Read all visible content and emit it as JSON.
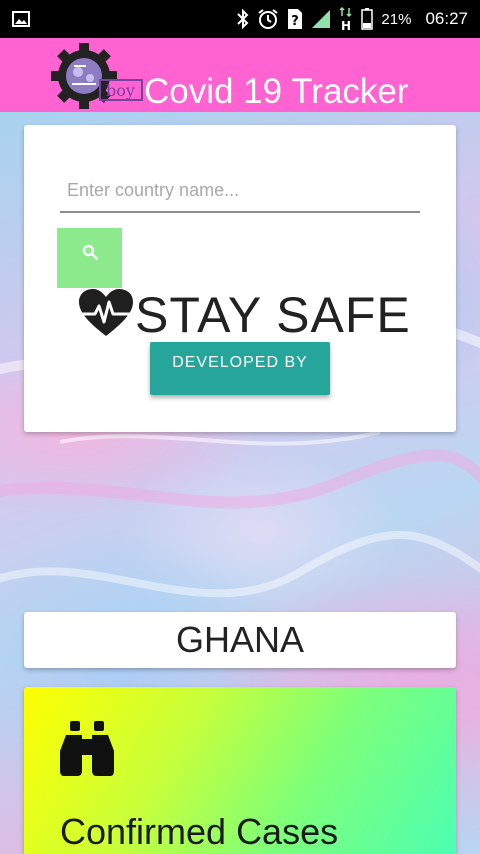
{
  "status_bar": {
    "battery": "21%",
    "time": "06:27",
    "icons": [
      "gallery-icon",
      "bluetooth-icon",
      "alarm-icon",
      "sim-unknown-icon",
      "signal-icon",
      "data-h-icon",
      "battery-icon"
    ]
  },
  "app_bar": {
    "title": "Covid 19 Tracker",
    "logo_text": "boy",
    "color": "#ff62d1"
  },
  "search": {
    "placeholder": "Enter country name...",
    "value": "",
    "button_color": "#8ce98c",
    "button_icon": "search-icon"
  },
  "banner": {
    "icon": "heart-pulse-icon",
    "text": "STAY SAFE"
  },
  "developed_button": {
    "label": "DEVELOPED BY",
    "color": "#26a69a"
  },
  "country": {
    "name": "GHANA"
  },
  "stats": {
    "confirmed": {
      "icon": "binoculars-icon",
      "label": "Confirmed Cases"
    }
  }
}
